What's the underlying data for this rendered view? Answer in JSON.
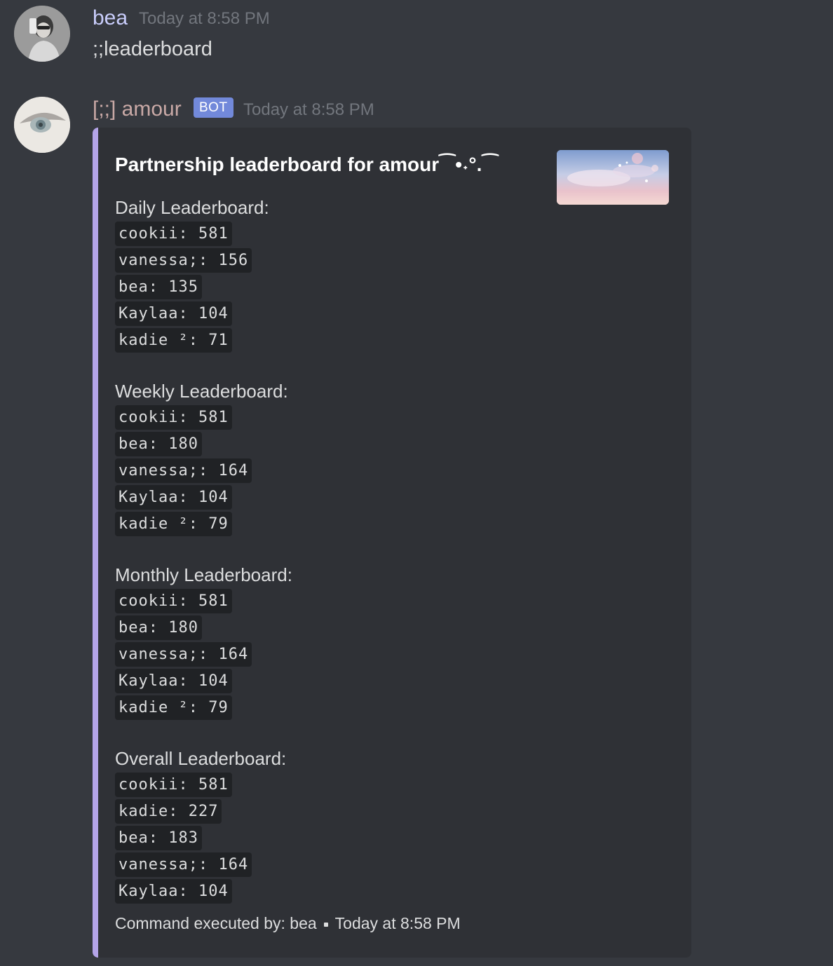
{
  "message1": {
    "author": "bea",
    "timestamp": "Today at 8:58 PM",
    "content": ";;leaderboard"
  },
  "message2": {
    "author": "[;;] amour",
    "bot_tag": "BOT",
    "timestamp": "Today at 8:58 PM",
    "embed": {
      "accent_color": "#b4a4e8",
      "title": "Partnership leaderboard for amour⁀•˖°.⁀",
      "sections": [
        {
          "heading": "Daily Leaderboard:",
          "entries": [
            "cookii: 581",
            "vanessa;: 156",
            "bea: 135",
            "Kaylaa: 104",
            "kadie ²: 71"
          ]
        },
        {
          "heading": "Weekly Leaderboard:",
          "entries": [
            "cookii: 581",
            "bea: 180",
            "vanessa;: 164",
            "Kaylaa: 104",
            "kadie ²: 79"
          ]
        },
        {
          "heading": "Monthly Leaderboard:",
          "entries": [
            "cookii: 581",
            "bea: 180",
            "vanessa;: 164",
            "Kaylaa: 104",
            "kadie ²: 79"
          ]
        },
        {
          "heading": "Overall Leaderboard:",
          "entries": [
            "cookii: 581",
            "kadie: 227",
            "bea: 183",
            "vanessa;: 164",
            "Kaylaa: 104"
          ]
        }
      ],
      "footer_text": "Command executed by: bea",
      "footer_timestamp": "Today at 8:58 PM"
    }
  }
}
